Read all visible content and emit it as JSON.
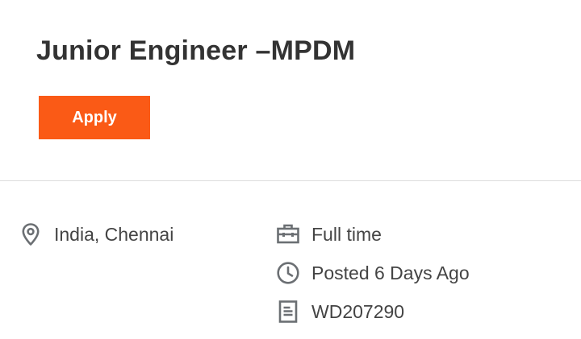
{
  "job": {
    "title": "Junior Engineer –MPDM",
    "apply_label": "Apply"
  },
  "details": {
    "location": {
      "text": "India, Chennai",
      "icon": "map-pin-icon"
    },
    "time_type": {
      "text": "Full time",
      "icon": "briefcase-icon"
    },
    "posted": {
      "text": "Posted 6 Days Ago",
      "icon": "clock-icon"
    },
    "job_id": {
      "text": "WD207290",
      "icon": "document-icon"
    }
  },
  "colors": {
    "accent": "#fa5a16",
    "title": "#333333",
    "text": "#444444",
    "icon": "#6b6f73",
    "divider": "#dcdcdc"
  }
}
